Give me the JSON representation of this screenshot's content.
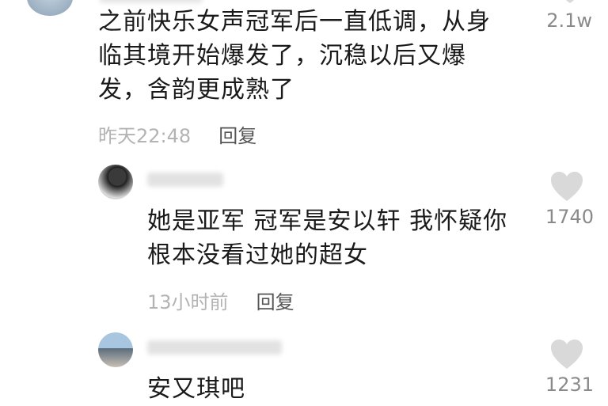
{
  "comments": [
    {
      "text_lines": [
        "之前快乐女声冠军后一直低调，从身",
        "临其境开始爆发了，沉稳以后又爆",
        "发，含韵更成熟了"
      ],
      "time": "昨天22:48",
      "reply": "回复",
      "likes": "2.1w"
    },
    {
      "text_lines": [
        "她是亚军 冠军是安以轩 我怀疑你",
        "根本没看过她的超女"
      ],
      "time": "13小时前",
      "reply": "回复",
      "likes": "1740"
    },
    {
      "text_lines": [
        "安又琪吧"
      ],
      "likes": "1231"
    }
  ],
  "icons": {
    "like": "heart-icon"
  },
  "colors": {
    "heart": "#d9d9d9",
    "meta": "#b3b3b3"
  }
}
